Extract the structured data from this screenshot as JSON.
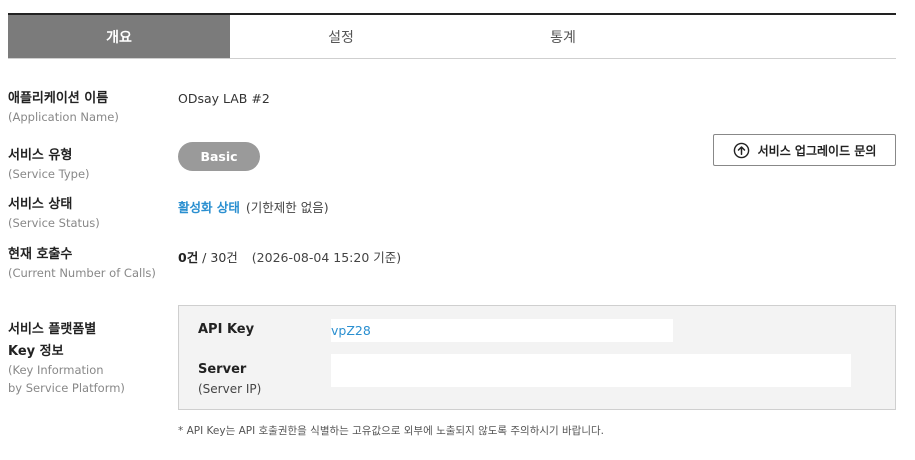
{
  "tabs": [
    {
      "label": "개요",
      "active": true
    },
    {
      "label": "설정",
      "active": false
    },
    {
      "label": "통계",
      "active": false
    }
  ],
  "app_name": {
    "label": "애플리케이션 이름",
    "sub": "(Application Name)",
    "value": "ODsay LAB #2"
  },
  "service_type": {
    "label": "서비스 유형",
    "sub": "(Service Type)",
    "badge": "Basic"
  },
  "upgrade_button": {
    "label": "서비스 업그레이드 문의",
    "icon": "arrow-up-circle-icon"
  },
  "service_status": {
    "label": "서비스 상태",
    "sub": "(Service Status)",
    "status": "활성화 상태",
    "note": "(기한제한 없음)"
  },
  "calls": {
    "label": "현재 호출수",
    "sub": "(Current Number of Calls)",
    "current": "0건",
    "separator": " / ",
    "limit": "30건",
    "date_note": "(2026-08-04 15:20 기준)"
  },
  "key_info": {
    "label_line1": "서비스 플랫폼별",
    "label_line2": "Key 정보",
    "sub_line1": "(Key Information",
    "sub_line2": "by Service Platform)",
    "api_key_label": "API Key",
    "api_key_value": "vpZ28",
    "server_label": "Server",
    "server_sub": "(Server IP)",
    "server_value": ""
  },
  "note": "* API Key는 API 호출권한을 식별하는 고유값으로 외부에 노출되지 않도록 주의하시기 바랍니다.",
  "colors": {
    "active_tab": "#7b7b7b",
    "badge": "#9a9a9a",
    "accent": "#2a8fd0",
    "keybox_bg": "#f3f3f3"
  }
}
